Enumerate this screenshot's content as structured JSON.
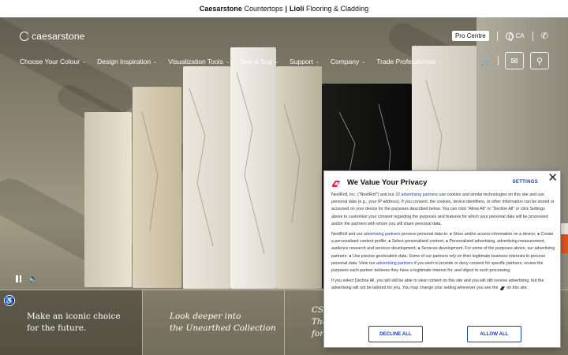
{
  "topbar": {
    "brand1": "Caesarstone",
    "text1": "Countertops",
    "separator": "|",
    "brand2": "Lioli",
    "text2": "Flooring & Cladding"
  },
  "header": {
    "logo_text": "caesarstone",
    "pro_centre": "Pro Centre",
    "region": "CA",
    "phone_icon": "phone-icon"
  },
  "nav": {
    "items": [
      {
        "label": "Choose Your Colour"
      },
      {
        "label": "Design Inspiration"
      },
      {
        "label": "Visualization Tools"
      },
      {
        "label": "See & Buy"
      },
      {
        "label": "Support"
      },
      {
        "label": "Company"
      },
      {
        "label": "Trade Professionals"
      }
    ],
    "chevron": "⌄"
  },
  "cards": [
    {
      "line1": "Make an iconic choice",
      "line2": "for the future."
    },
    {
      "line1": "Look deeper into",
      "line2": "the Unearthed Collection"
    },
    {
      "line1": "CS",
      "line2": "The",
      "line3": "for"
    }
  ],
  "privacy": {
    "title": "We Value Your Privacy",
    "settings": "SETTINGS",
    "close": "✕",
    "p1_a": "NextRoll, Inc. (\"NextRoll\") and our ",
    "p1_link": "22 advertising partners",
    "p1_b": " use cookies and similar technologies on this site and use personal data (e.g., your IP address). If you consent, the cookies, device identifiers, or other information can be stored or accessed on your device for the purposes described below. You can click \"Allow All\" or \"Decline All\" or click Settings above to customise your consent regarding the purposes and features for which your personal data will be processed and/or the partners with whom you will share personal data.",
    "p2_a": "NextRoll and our ",
    "p2_link": "advertising partners",
    "p2_b": " process personal data to: ● Store and/or access information on a device; ● Create a personalised content profile; ● Select personalised content; ● Personalised advertising, advertising measurement, audience research and services development; ● Services development. For some of the purposes above, our advertising partners: ● Use precise geolocation data. Some of our partners rely on their legitimate business interests to process personal data. View our ",
    "p2_link2": "advertising partners",
    "p2_c": " if you wish to provide or deny consent for specific partners, review the purposes each partner believes they have a legitimate interest for, and object to such processing.",
    "p3_a": "If you select Decline All, you will still be able to view content on this site and you will still receive advertising, but the advertising will not be tailored for you. You may change your setting whenever you see the ",
    "p3_b": " on this site.",
    "decline": "DECLINE ALL",
    "allow": "ALLOW ALL"
  },
  "colors": {
    "link_blue": "#1a3fb8",
    "accent_orange": "#d8541f"
  }
}
